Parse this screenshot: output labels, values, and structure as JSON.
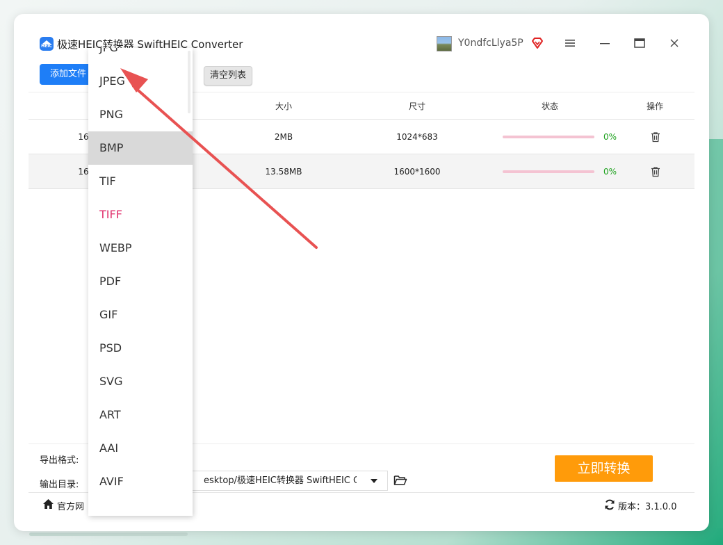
{
  "app": {
    "title": "极速HEIC转换器 SwiftHEIC Converter",
    "logo_text": "HEIC",
    "username": "Y0ndfcLlya5P"
  },
  "toolbar": {
    "add_files": "添加文件",
    "clear_list": "清空列表"
  },
  "table": {
    "headers": [
      "大小",
      "尺寸",
      "状态",
      "操作"
    ],
    "rows": [
      {
        "name": "16",
        "size": "2MB",
        "dimensions": "1024*683",
        "progress": 0,
        "status": "0%"
      },
      {
        "name": "16",
        "size": "13.58MB",
        "dimensions": "1600*1600",
        "progress": 0,
        "status": "0%"
      }
    ]
  },
  "bottom": {
    "format_label": "导出格式:",
    "dir_label": "输出目录:",
    "output_path": "esktop/极速HEIC转换器 SwiftHEIC Con",
    "convert_button": "立即转换"
  },
  "status": {
    "site_link": "官方网",
    "version": "版本：3.1.0.0"
  },
  "format_dropdown": {
    "options": [
      "JPG",
      "JPEG",
      "PNG",
      "BMP",
      "TIF",
      "TIFF",
      "WEBP",
      "PDF",
      "GIF",
      "PSD",
      "SVG",
      "ART",
      "AAI",
      "AVIF"
    ],
    "hovered": "BMP",
    "selected": "TIFF"
  },
  "colors": {
    "primary": "#1e7ef7",
    "convert": "#ff9b0a",
    "selected_text": "#e0306c",
    "progress_track": "#f4c3d2",
    "status_ok": "#22a322",
    "annotation_arrow": "#e85252"
  }
}
